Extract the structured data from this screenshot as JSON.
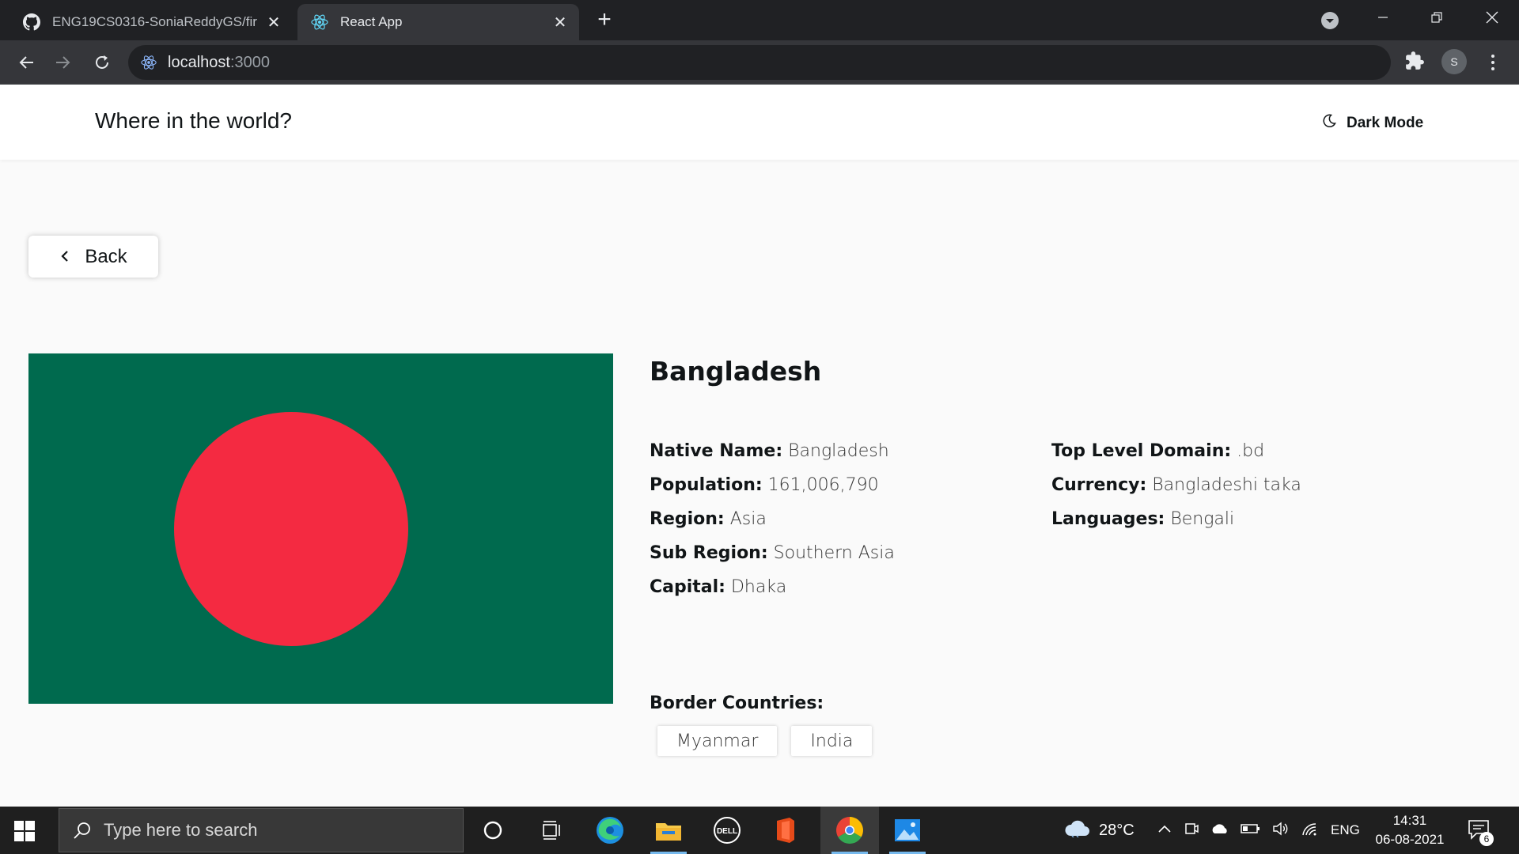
{
  "browser": {
    "tabs": [
      {
        "title": "ENG19CS0316-SoniaReddyGS/fir",
        "favicon": "github-icon",
        "active": false
      },
      {
        "title": "React App",
        "favicon": "react-icon",
        "active": true
      }
    ],
    "url_host": "localhost",
    "url_port": ":3000",
    "profile_initial": "S"
  },
  "app": {
    "title": "Where in the world?",
    "dark_mode_label": "Dark Mode",
    "back_label": "Back"
  },
  "country": {
    "name": "Bangladesh",
    "flag_colors": {
      "field": "#006a4e",
      "disc": "#f42a41"
    },
    "details_left": [
      {
        "label": "Native Name:",
        "value": "Bangladesh"
      },
      {
        "label": "Population:",
        "value": "161,006,790"
      },
      {
        "label": "Region:",
        "value": "Asia"
      },
      {
        "label": "Sub Region:",
        "value": "Southern Asia"
      },
      {
        "label": "Capital:",
        "value": "Dhaka"
      }
    ],
    "details_right": [
      {
        "label": "Top Level Domain:",
        "value": ".bd"
      },
      {
        "label": "Currency:",
        "value": "Bangladeshi taka"
      },
      {
        "label": "Languages:",
        "value": "Bengali"
      }
    ],
    "border_label": "Border Countries:",
    "borders": [
      "Myanmar",
      "India"
    ]
  },
  "taskbar": {
    "search_placeholder": "Type here to search",
    "temperature": "28°C",
    "language": "ENG",
    "time": "14:31",
    "date": "06-08-2021",
    "notification_count": "6",
    "apps": [
      "cortana-icon",
      "task-view-icon",
      "edge-icon",
      "file-explorer-icon",
      "dell-icon",
      "office-icon",
      "chrome-icon",
      "photos-icon"
    ]
  }
}
